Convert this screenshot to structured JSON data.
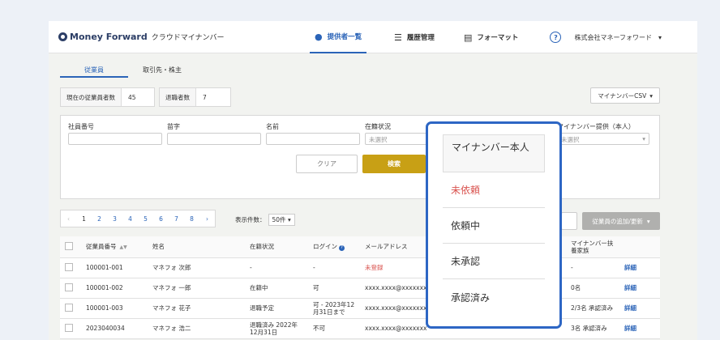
{
  "app": {
    "brand": "Money Forward",
    "product": "クラウドマイナンバー"
  },
  "nav": {
    "items": [
      {
        "label": "提供者一覧",
        "icon": "person-icon",
        "active": true
      },
      {
        "label": "履歴管理",
        "icon": "list-icon",
        "active": false
      },
      {
        "label": "フォーマット",
        "icon": "document-icon",
        "active": false
      }
    ],
    "help_icon": "?",
    "company": "株式会社マネーフォワード",
    "company_caret": "▾"
  },
  "subtabs": [
    "従業員",
    "取引先・株主"
  ],
  "stats": {
    "current_label": "現在の従業員者数",
    "current_value": "45",
    "retired_label": "退職者数",
    "retired_value": "7"
  },
  "csv_button": "マイナンバーCSV",
  "search": {
    "fields": [
      {
        "label": "社員番号",
        "value": ""
      },
      {
        "label": "苗字",
        "value": ""
      },
      {
        "label": "名前",
        "value": ""
      },
      {
        "label": "在籍状況",
        "value": "未選択"
      },
      {
        "label": "マイナンバー提供（本人）",
        "value": "未選択"
      }
    ],
    "clear": "クリア",
    "submit": "検索"
  },
  "pager": {
    "prev": "‹",
    "pages": [
      "1",
      "2",
      "3",
      "4",
      "5",
      "6",
      "7",
      "8"
    ],
    "next": "›",
    "current": "1",
    "per_page_label": "表示件数：",
    "per_page_value": "50件"
  },
  "add_button": "従業員の追加/更新",
  "table": {
    "headers": [
      "従業員番号",
      "姓名",
      "在籍状況",
      "ログイン",
      "メールアドレス",
      "マイナンバー扶養家族"
    ],
    "rows": [
      {
        "id": "100001-001",
        "name": "マネフォ 次郎",
        "status": "-",
        "login": "-",
        "email": "未登録",
        "family": "-",
        "detail": "詳細"
      },
      {
        "id": "100001-002",
        "name": "マネフォ 一郎",
        "status": "在籍中",
        "login": "可",
        "email": "xxxx.xxxx@xxxxxxx",
        "family": "0名",
        "detail": "詳細"
      },
      {
        "id": "100001-003",
        "name": "マネフォ 花子",
        "status": "退職予定",
        "login": "可 - 2023年12月31日まで",
        "email": "xxxx.xxxx@xxxxxxx",
        "family": "2/3名 承認済み",
        "detail": "詳細"
      },
      {
        "id": "2023040034",
        "name": "マネフォ 浩二",
        "status": "退職済み 2022年12月31日",
        "login": "不可",
        "email": "xxxx.xxxx@xxxxxxx",
        "family": "3名 承認済み",
        "detail": "詳細"
      }
    ]
  },
  "popup": {
    "header": "マイナンバー本人",
    "options": [
      "未依頼",
      "依頼中",
      "未承認",
      "承認済み"
    ]
  }
}
